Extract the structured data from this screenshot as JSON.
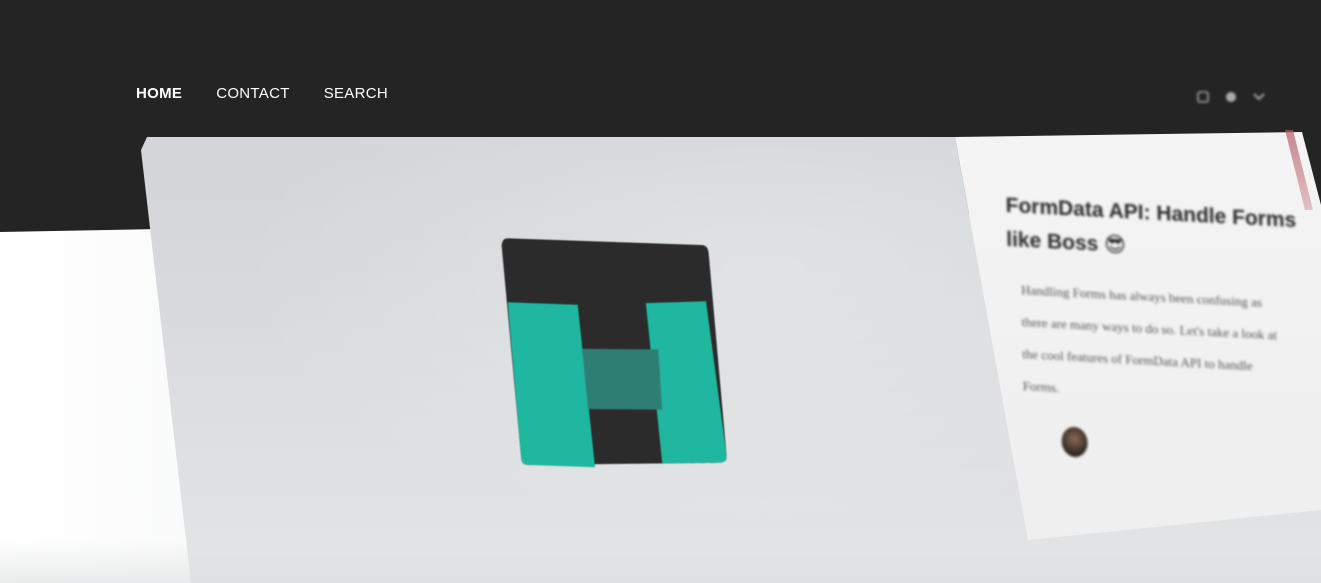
{
  "nav": {
    "links": [
      {
        "label": "HOME"
      },
      {
        "label": "CONTACT"
      },
      {
        "label": "SEARCH"
      }
    ],
    "icons": [
      "rss-icon",
      "ghost-icon",
      "twitter-icon"
    ]
  },
  "featured_post": {
    "title": "FormData API: Handle Forms like Boss 😎",
    "excerpt": "Handling Forms has always been confusing as there are many ways to do so. Let's take a look at the cool features of FormData API to handle Forms.",
    "colors": {
      "logo_teal": "#1fb7a0",
      "logo_dark": "#2b2b2b",
      "nav_background": "#242424"
    }
  }
}
